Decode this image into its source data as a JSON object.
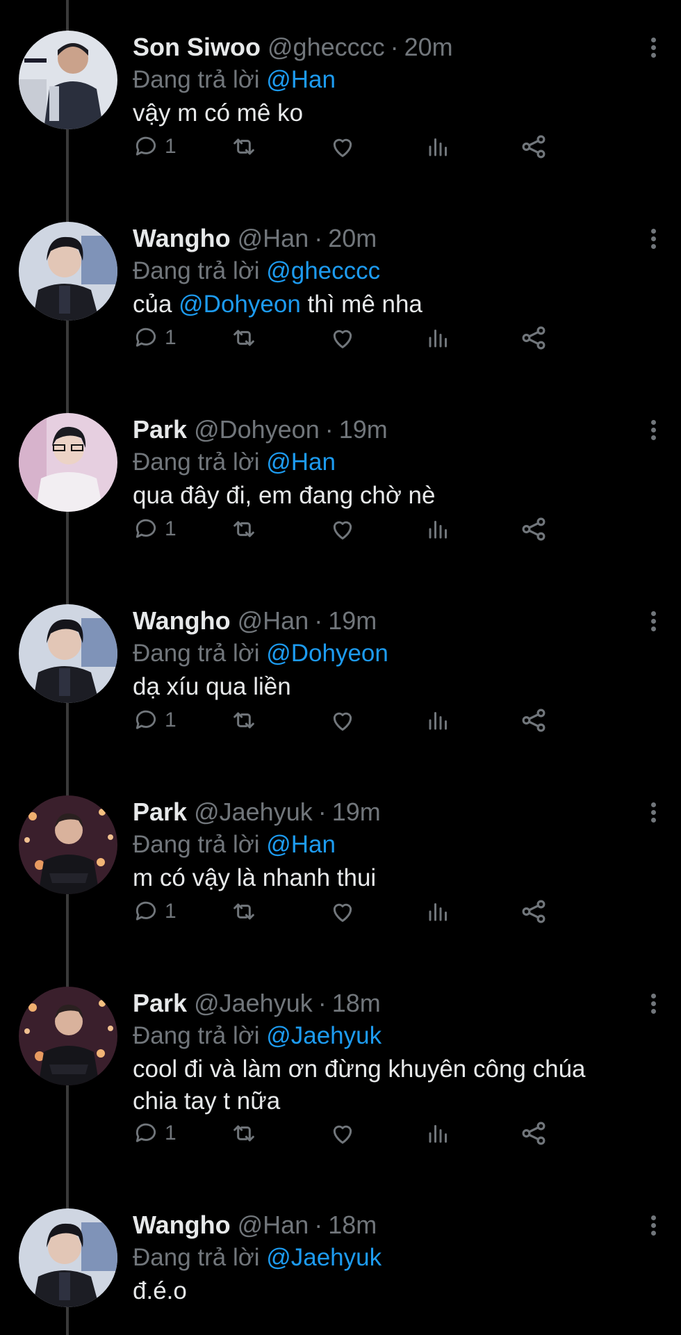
{
  "colors": {
    "background": "#000000",
    "text": "#e7e9ea",
    "muted": "#71767b",
    "mention": "#1d9bf0"
  },
  "reply_prefix": "Đang trả lời",
  "tweets": [
    {
      "name": "Son Siwoo",
      "handle": "@ghecccc",
      "time": "20m",
      "reply_to": "@Han",
      "text_parts": [
        "vậy m có mê ko"
      ],
      "mention_in_text": "",
      "text_after": "",
      "reply_count": "1",
      "avatar": "avatar-siwoo"
    },
    {
      "name": "Wangho",
      "handle": "@Han",
      "time": "20m",
      "reply_to": "@ghecccc",
      "text_parts": [
        "của "
      ],
      "mention_in_text": "@Dohyeon",
      "text_after": " thì mê nha",
      "reply_count": "1",
      "avatar": "avatar-wangho"
    },
    {
      "name": "Park",
      "handle": "@Dohyeon",
      "time": "19m",
      "reply_to": "@Han",
      "text_parts": [
        "qua đây đi, em đang chờ nè"
      ],
      "mention_in_text": "",
      "text_after": "",
      "reply_count": "1",
      "avatar": "avatar-dohyeon"
    },
    {
      "name": "Wangho",
      "handle": "@Han",
      "time": "19m",
      "reply_to": "@Dohyeon",
      "text_parts": [
        "dạ xíu qua liền"
      ],
      "mention_in_text": "",
      "text_after": "",
      "reply_count": "1",
      "avatar": "avatar-wangho"
    },
    {
      "name": "Park",
      "handle": "@Jaehyuk",
      "time": "19m",
      "reply_to": "@Han",
      "text_parts": [
        "m có vậy là nhanh thui"
      ],
      "mention_in_text": "",
      "text_after": "",
      "reply_count": "1",
      "avatar": "avatar-jaehyuk"
    },
    {
      "name": "Park",
      "handle": "@Jaehyuk",
      "time": "18m",
      "reply_to": "@Jaehyuk",
      "text_parts": [
        "cool đi và làm ơn đừng khuyên công chúa chia tay t nữa"
      ],
      "mention_in_text": "",
      "text_after": "",
      "reply_count": "1",
      "avatar": "avatar-jaehyuk"
    },
    {
      "name": "Wangho",
      "handle": "@Han",
      "time": "18m",
      "reply_to": "@Jaehyuk",
      "text_parts": [
        "đ.é.o"
      ],
      "mention_in_text": "",
      "text_after": "",
      "reply_count": "",
      "avatar": "avatar-wangho"
    }
  ],
  "separator": "·",
  "icons": [
    "reply-icon",
    "retweet-icon",
    "like-icon",
    "views-icon",
    "share-icon",
    "more-icon"
  ]
}
